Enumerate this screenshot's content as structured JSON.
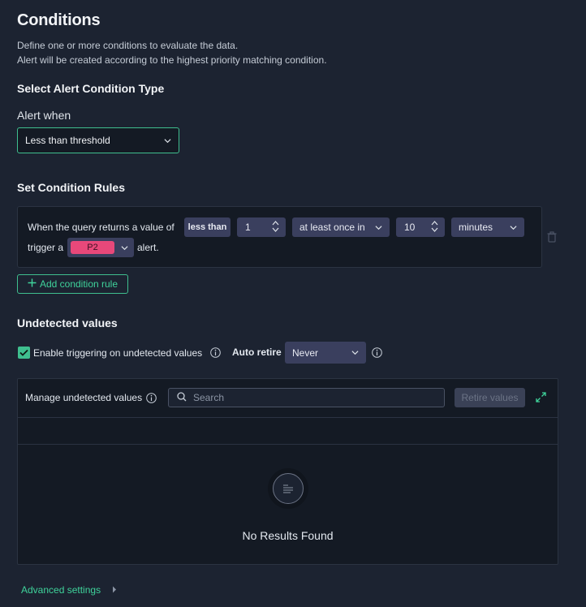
{
  "header": {
    "title": "Conditions",
    "desc_line1": "Define one or more conditions to evaluate the data.",
    "desc_line2": "Alert will be created according to the highest priority matching condition."
  },
  "condition_type": {
    "title": "Select Alert Condition Type",
    "alert_when_label": "Alert when",
    "alert_when_value": "Less than threshold"
  },
  "rules": {
    "title": "Set Condition Rules",
    "prefix_text": "When the query returns a value of",
    "operator": "less than",
    "threshold_value": "1",
    "frequency": "at least once in",
    "window_value": "10",
    "window_unit": "minutes",
    "trigger_text": "trigger a",
    "priority": "P2",
    "suffix_text": "alert.",
    "priority_color": "#e8487a",
    "add_rule_label": "Add condition rule"
  },
  "undetected": {
    "title": "Undetected values",
    "enable_label": "Enable triggering on undetected values",
    "enable_checked": true,
    "auto_retire_label": "Auto retire",
    "auto_retire_value": "Never",
    "manage_label": "Manage undetected values",
    "search_placeholder": "Search",
    "retire_button": "Retire values",
    "empty_text": "No Results Found"
  },
  "advanced": {
    "label": "Advanced settings"
  },
  "colors": {
    "accent": "#3fbf8f",
    "background": "#1c2331",
    "panel": "#141a24"
  }
}
